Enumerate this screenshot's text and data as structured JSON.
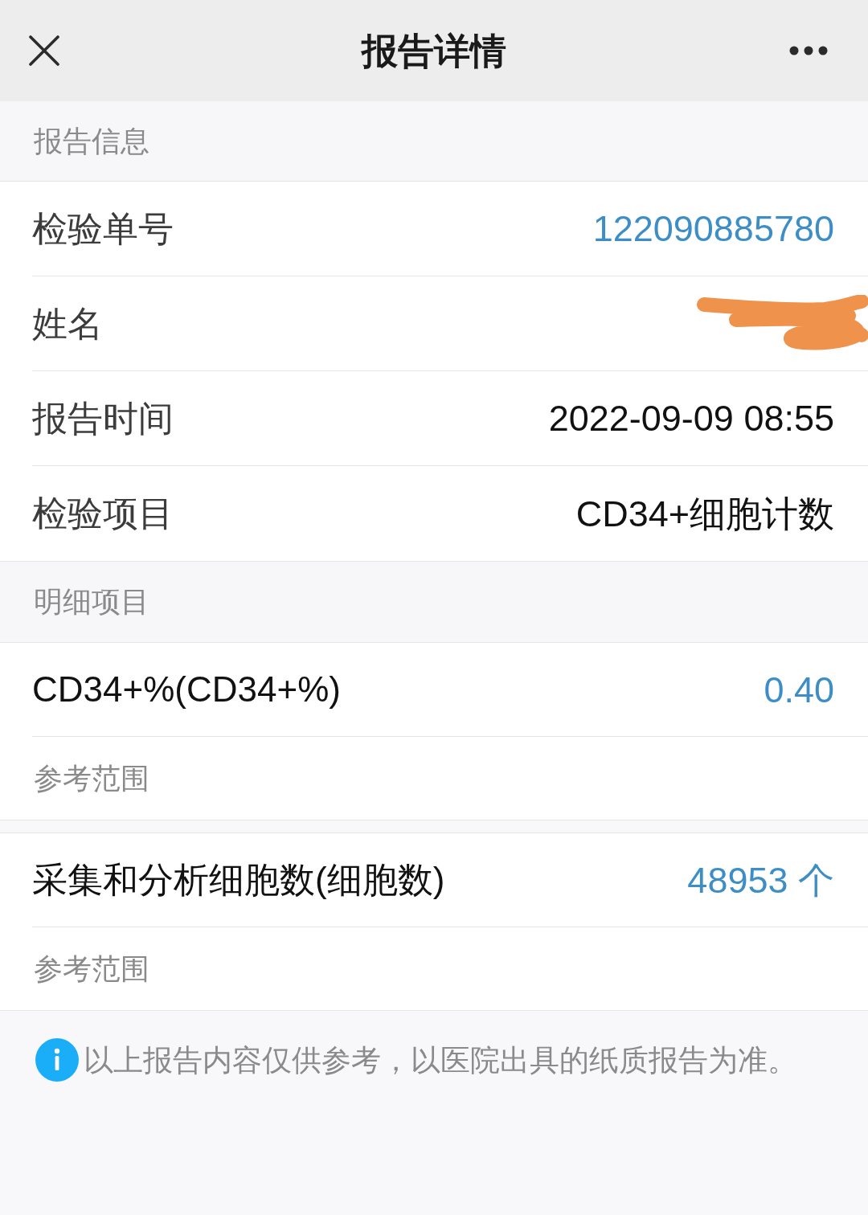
{
  "header": {
    "title": "报告详情"
  },
  "report_info": {
    "title": "报告信息",
    "rows": [
      {
        "kind": "text",
        "label": "检验单号",
        "value": "122090885780",
        "accent": true
      },
      {
        "kind": "redacted",
        "label": "姓名"
      },
      {
        "kind": "text",
        "label": "报告时间",
        "value": "2022-09-09 08:55",
        "accent": false
      },
      {
        "kind": "text",
        "label": "检验项目",
        "value": "CD34+细胞计数",
        "accent": false
      }
    ]
  },
  "details": {
    "title": "明细项目",
    "items": [
      {
        "name": "CD34+%(CD34+%)",
        "value": "0.40",
        "accent": true,
        "reference_label": "参考范围"
      },
      {
        "name": "采集和分析细胞数(细胞数)",
        "value": "48953 个",
        "accent": true,
        "reference_label": "参考范围"
      }
    ]
  },
  "notice": {
    "text": "以上报告内容仅供参考，以医院出具的纸质报告为准。"
  }
}
